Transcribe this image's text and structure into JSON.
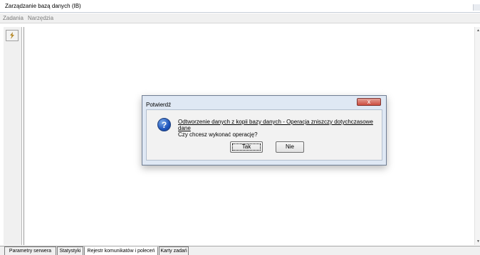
{
  "window": {
    "title": "Zarządzanie bazą danych (IB)"
  },
  "menu": [
    {
      "label": "Zadania"
    },
    {
      "label": "Narzędzia"
    }
  ],
  "tabs": [
    {
      "label": "Parametry serwera"
    },
    {
      "label": "Statystyki"
    },
    {
      "label": "Rejestr komunikatów i poleceń"
    },
    {
      "label": "Karty zadań"
    }
  ],
  "dialog": {
    "title": "Potwierdź",
    "close_symbol": "x",
    "message_line1": "Odtworzenie danych z kopii bazy danych - Operacja zniszczy dotychczasowe dane",
    "message_line2": "Czy chcesz wykonać operację?",
    "yes_label": "Tak",
    "no_label": "Nie",
    "icon_symbol": "?"
  },
  "icons": {
    "tool_button": "lightning-icon",
    "question": "question-icon"
  }
}
